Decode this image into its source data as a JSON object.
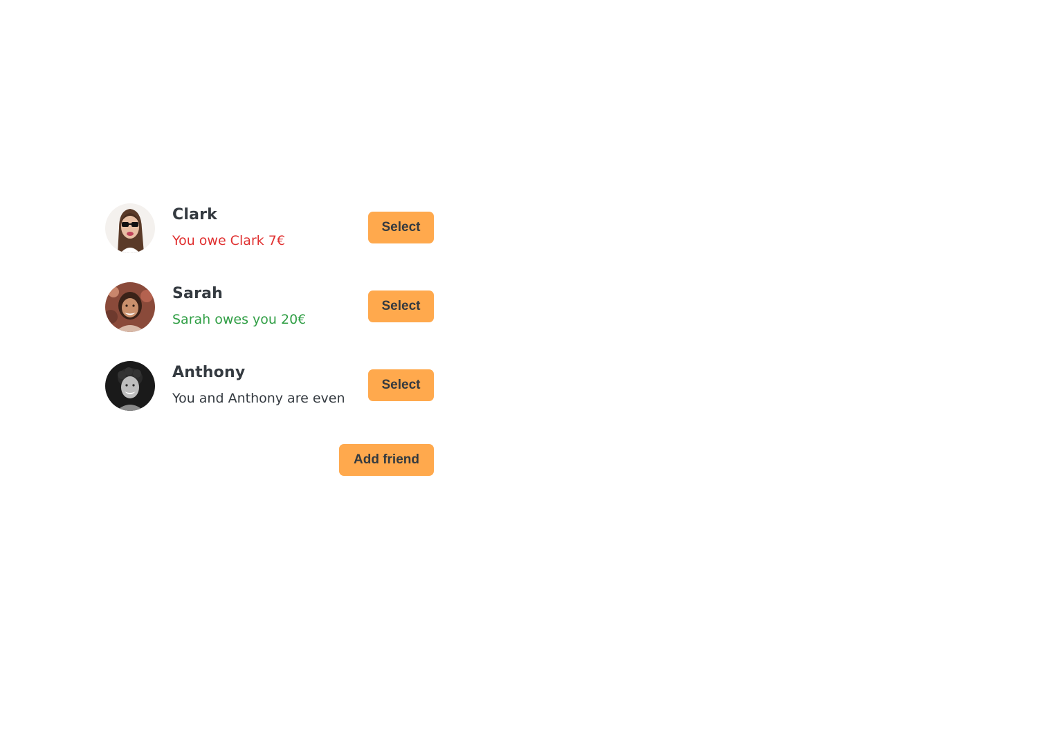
{
  "friends": [
    {
      "name": "Clark",
      "balance_text": "You owe Clark 7€",
      "balance_status": "owe",
      "balance_color": "#e03131",
      "avatar": "clark-avatar",
      "select_label": "Select"
    },
    {
      "name": "Sarah",
      "balance_text": "Sarah owes you 20€",
      "balance_status": "owed",
      "balance_color": "#2f9e44",
      "avatar": "sarah-avatar",
      "select_label": "Select"
    },
    {
      "name": "Anthony",
      "balance_text": "You and Anthony are even",
      "balance_status": "even",
      "balance_color": "#343a40",
      "avatar": "anthony-avatar",
      "select_label": "Select"
    }
  ],
  "add_friend_label": "Add friend",
  "colors": {
    "accent": "#ffa94d",
    "text": "#343a40",
    "owe": "#e03131",
    "owed": "#2f9e44"
  }
}
